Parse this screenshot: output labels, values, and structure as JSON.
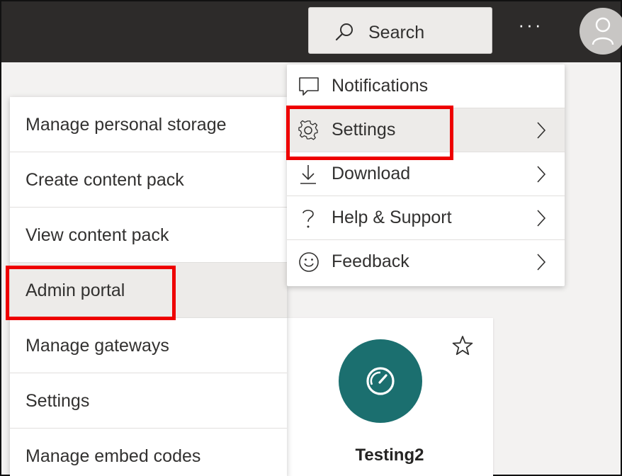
{
  "header": {
    "search_label": "Search",
    "more_label": "···",
    "search_icon": "search-icon",
    "avatar_icon": "person-icon"
  },
  "dropdown": {
    "items": [
      {
        "label": "Notifications",
        "icon": "chat-bubble-icon",
        "has_chevron": false
      },
      {
        "label": "Settings",
        "icon": "gear-icon",
        "has_chevron": true
      },
      {
        "label": "Download",
        "icon": "download-icon",
        "has_chevron": true
      },
      {
        "label": "Help & Support",
        "icon": "question-icon",
        "has_chevron": true
      },
      {
        "label": "Feedback",
        "icon": "smiley-icon",
        "has_chevron": true
      }
    ]
  },
  "settings_submenu": {
    "items": [
      {
        "label": "Manage personal storage"
      },
      {
        "label": "Create content pack"
      },
      {
        "label": "View content pack"
      },
      {
        "label": "Admin portal"
      },
      {
        "label": "Manage gateways"
      },
      {
        "label": "Settings"
      },
      {
        "label": "Manage embed codes"
      }
    ]
  },
  "card": {
    "title": "Testing2",
    "icon": "dashboard-gauge-icon",
    "favorite_icon": "star-icon",
    "circle_color": "#1b6f6f"
  },
  "colors": {
    "topbar": "#2d2b2a",
    "highlight": "#ee0000",
    "hover": "#edebe9"
  }
}
